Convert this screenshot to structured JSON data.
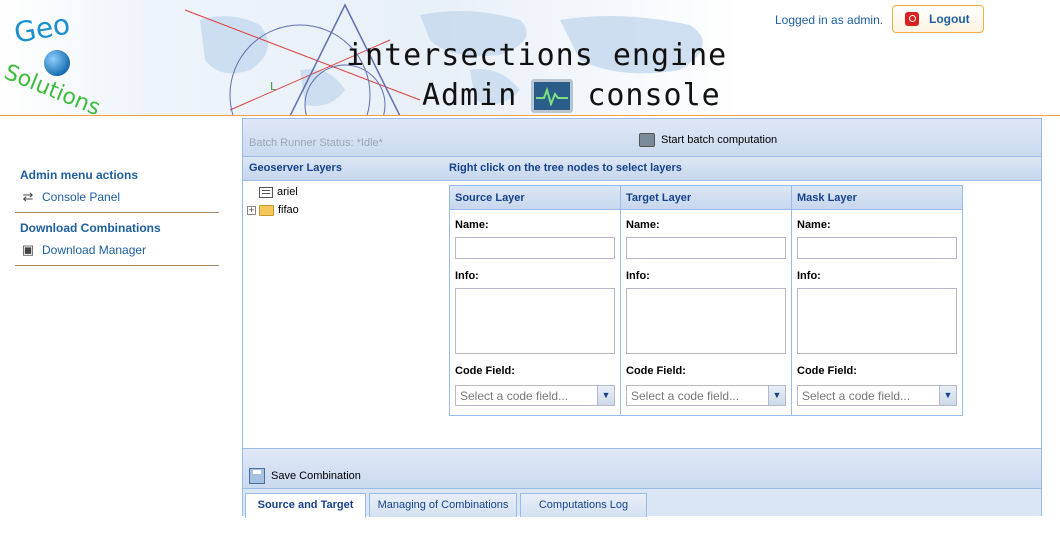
{
  "header": {
    "logo_geo": "Geo",
    "logo_solutions": "Solutions",
    "title_line1": "intersections engine",
    "title_admin": "Admin",
    "title_console": "console",
    "logged_in_text": "Logged in as admin.",
    "logout_label": "Logout"
  },
  "sidebar": {
    "sections": [
      {
        "heading": "Admin menu actions",
        "item": "Console Panel",
        "icon": "swap-arrows-icon"
      },
      {
        "heading": "Download Combinations",
        "item": "Download Manager",
        "icon": "download-manager-icon"
      }
    ]
  },
  "main": {
    "batch_status": "Batch Runner Status: *Idle*",
    "start_batch_label": "Start batch computation",
    "geoserver_layers_title": "Geoserver Layers",
    "right_click_hint": "Right click on the tree nodes to select layers",
    "tree": [
      {
        "label": "ariel",
        "type": "leaf"
      },
      {
        "label": "fifao",
        "type": "folder",
        "expander": "+"
      }
    ],
    "columns": [
      {
        "title": "Source Layer",
        "name_label": "Name:",
        "info_label": "Info:",
        "code_label": "Code Field:",
        "code_placeholder": "Select a code field..."
      },
      {
        "title": "Target Layer",
        "name_label": "Name:",
        "info_label": "Info:",
        "code_label": "Code Field:",
        "code_placeholder": "Select a code field..."
      },
      {
        "title": "Mask Layer",
        "name_label": "Name:",
        "info_label": "Info:",
        "code_label": "Code Field:",
        "code_placeholder": "Select a code field..."
      }
    ],
    "save_label": "Save Combination",
    "tabs": [
      {
        "label": "Source and Target",
        "active": true
      },
      {
        "label": "Managing of Combinations",
        "active": false
      },
      {
        "label": "Computations Log",
        "active": false
      }
    ]
  },
  "colors": {
    "accent_blue": "#1f5fa0",
    "panel_header_text": "#15428b",
    "panel_border": "#99bbe8",
    "header_rule": "#f0a040",
    "logout_border": "#f0b040"
  }
}
